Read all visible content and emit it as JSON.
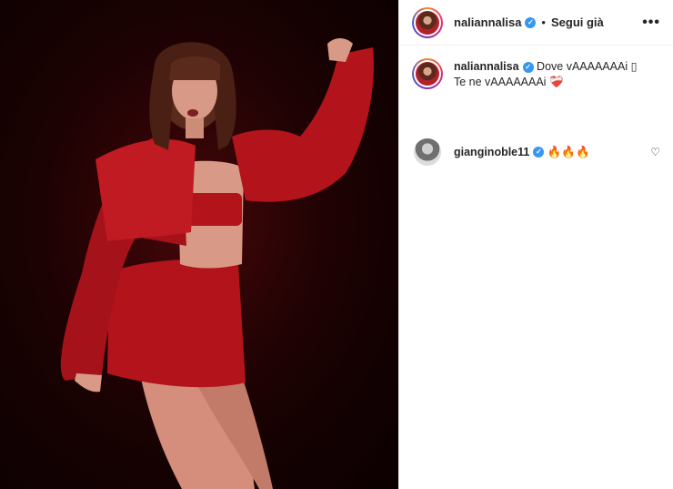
{
  "post": {
    "image_alt": "Performer on stage in red outfit",
    "colors": {
      "background": "#1c0203",
      "outfit": "#b3141c",
      "skin": "#d89a86"
    }
  },
  "header": {
    "username": "naliannalisa",
    "separator": "•",
    "follow_label": "Segui già",
    "more_label": "•••"
  },
  "caption": {
    "username": "naliannalisa",
    "line1": "Dove vAAAAAAAi ▯",
    "line2": "Te ne vAAAAAAAi",
    "emoji": "❤️‍🩹"
  },
  "comments": [
    {
      "username": "gianginoble11",
      "text": "🔥🔥🔥",
      "like_icon": "heart-outline-icon"
    }
  ],
  "accent_colors": {
    "verified": "#3897f0",
    "text": "#262626"
  }
}
